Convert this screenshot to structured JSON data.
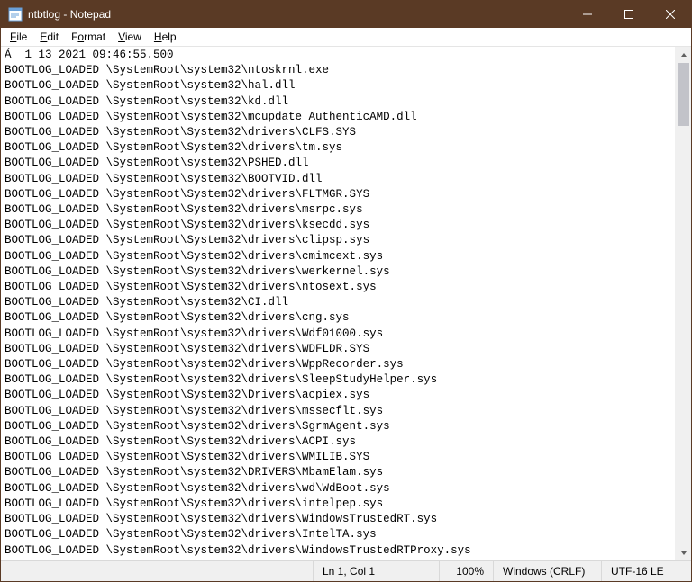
{
  "window": {
    "title": "ntbtlog - Notepad"
  },
  "menus": {
    "file": "File",
    "edit": "Edit",
    "format": "Format",
    "view": "View",
    "help": "Help"
  },
  "lines": [
    "Á  1 13 2021 09:46:55.500",
    "BOOTLOG_LOADED \\SystemRoot\\system32\\ntoskrnl.exe",
    "BOOTLOG_LOADED \\SystemRoot\\system32\\hal.dll",
    "BOOTLOG_LOADED \\SystemRoot\\system32\\kd.dll",
    "BOOTLOG_LOADED \\SystemRoot\\system32\\mcupdate_AuthenticAMD.dll",
    "BOOTLOG_LOADED \\SystemRoot\\System32\\drivers\\CLFS.SYS",
    "BOOTLOG_LOADED \\SystemRoot\\System32\\drivers\\tm.sys",
    "BOOTLOG_LOADED \\SystemRoot\\system32\\PSHED.dll",
    "BOOTLOG_LOADED \\SystemRoot\\system32\\BOOTVID.dll",
    "BOOTLOG_LOADED \\SystemRoot\\System32\\drivers\\FLTMGR.SYS",
    "BOOTLOG_LOADED \\SystemRoot\\System32\\drivers\\msrpc.sys",
    "BOOTLOG_LOADED \\SystemRoot\\System32\\drivers\\ksecdd.sys",
    "BOOTLOG_LOADED \\SystemRoot\\System32\\drivers\\clipsp.sys",
    "BOOTLOG_LOADED \\SystemRoot\\System32\\drivers\\cmimcext.sys",
    "BOOTLOG_LOADED \\SystemRoot\\System32\\drivers\\werkernel.sys",
    "BOOTLOG_LOADED \\SystemRoot\\System32\\drivers\\ntosext.sys",
    "BOOTLOG_LOADED \\SystemRoot\\system32\\CI.dll",
    "BOOTLOG_LOADED \\SystemRoot\\System32\\drivers\\cng.sys",
    "BOOTLOG_LOADED \\SystemRoot\\system32\\drivers\\Wdf01000.sys",
    "BOOTLOG_LOADED \\SystemRoot\\system32\\drivers\\WDFLDR.SYS",
    "BOOTLOG_LOADED \\SystemRoot\\system32\\drivers\\WppRecorder.sys",
    "BOOTLOG_LOADED \\SystemRoot\\system32\\drivers\\SleepStudyHelper.sys",
    "BOOTLOG_LOADED \\SystemRoot\\System32\\Drivers\\acpiex.sys",
    "BOOTLOG_LOADED \\SystemRoot\\system32\\drivers\\mssecflt.sys",
    "BOOTLOG_LOADED \\SystemRoot\\system32\\drivers\\SgrmAgent.sys",
    "BOOTLOG_LOADED \\SystemRoot\\System32\\drivers\\ACPI.sys",
    "BOOTLOG_LOADED \\SystemRoot\\System32\\drivers\\WMILIB.SYS",
    "BOOTLOG_LOADED \\SystemRoot\\system32\\DRIVERS\\MbamElam.sys",
    "BOOTLOG_LOADED \\SystemRoot\\system32\\drivers\\wd\\WdBoot.sys",
    "BOOTLOG_LOADED \\SystemRoot\\System32\\drivers\\intelpep.sys",
    "BOOTLOG_LOADED \\SystemRoot\\system32\\drivers\\WindowsTrustedRT.sys",
    "BOOTLOG_LOADED \\SystemRoot\\System32\\drivers\\IntelTA.sys",
    "BOOTLOG_LOADED \\SystemRoot\\system32\\drivers\\WindowsTrustedRTProxy.sys"
  ],
  "status": {
    "position": "Ln 1, Col 1",
    "zoom": "100%",
    "eol": "Windows (CRLF)",
    "encoding": "UTF-16 LE"
  }
}
